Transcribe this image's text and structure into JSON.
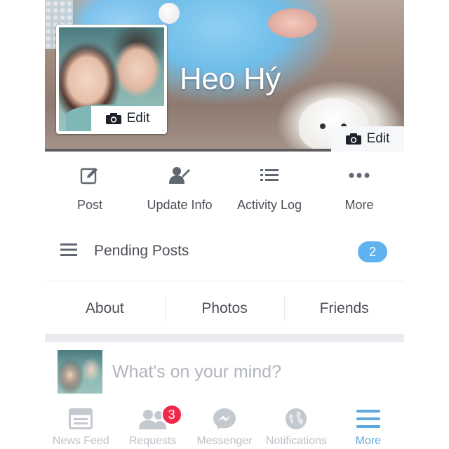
{
  "profile": {
    "name": "Heo Hý",
    "avatar_edit_label": "Edit",
    "cover_edit_label": "Edit"
  },
  "actions": [
    {
      "label": "Post",
      "icon": "compose-icon"
    },
    {
      "label": "Update Info",
      "icon": "person-edit-icon"
    },
    {
      "label": "Activity Log",
      "icon": "list-icon"
    },
    {
      "label": "More",
      "icon": "more-dots-icon"
    }
  ],
  "pending": {
    "label": "Pending Posts",
    "count": "2"
  },
  "tabs": [
    {
      "label": "About"
    },
    {
      "label": "Photos"
    },
    {
      "label": "Friends"
    }
  ],
  "composer": {
    "placeholder": "What's on your mind?"
  },
  "tabbar": [
    {
      "label": "News Feed",
      "icon": "news-feed-icon"
    },
    {
      "label": "Requests",
      "icon": "friend-requests-icon",
      "badge": "3"
    },
    {
      "label": "Messenger",
      "icon": "messenger-icon"
    },
    {
      "label": "Notifications",
      "icon": "globe-icon"
    },
    {
      "label": "More",
      "icon": "hamburger-icon",
      "active": true
    }
  ],
  "colors": {
    "accent_blue": "#5fb2f0",
    "active_tab": "#5fa8e0",
    "badge_red": "#f02849",
    "text": "#4b4f56",
    "inactive_icon": "#bdc1c9"
  }
}
